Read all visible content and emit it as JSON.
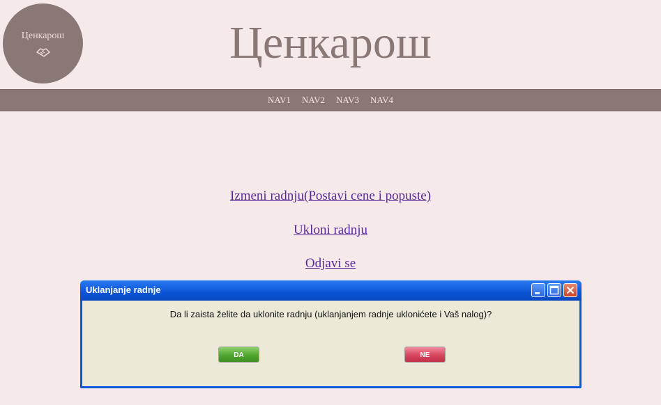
{
  "logo": {
    "text": "Ценкарош",
    "icon": "handshake-icon"
  },
  "site_title": "Ценкарош",
  "nav": {
    "items": [
      "NAV1",
      "NAV2",
      "NAV3",
      "NAV4"
    ]
  },
  "menu": {
    "edit_store": "Izmeni radnju(Postavi cene i popuste)",
    "remove_store": "Ukloni radnju",
    "logout": "Odjavi se"
  },
  "dialog": {
    "title": "Uklanjanje radnje",
    "message": "Da li zaista želite da uklonite radnju (uklanjanjem radnje uklonićete i Vaš nalog)?",
    "yes_label": "DA",
    "no_label": "NE",
    "titlebar_buttons": [
      "minimize-icon",
      "maximize-icon",
      "close-icon"
    ]
  },
  "colors": {
    "background": "#f6e9e9",
    "brand": "#8a7877",
    "link": "#5a2a9a",
    "dialog_frame": "#0b57d8",
    "dialog_body": "#ece9d8"
  }
}
